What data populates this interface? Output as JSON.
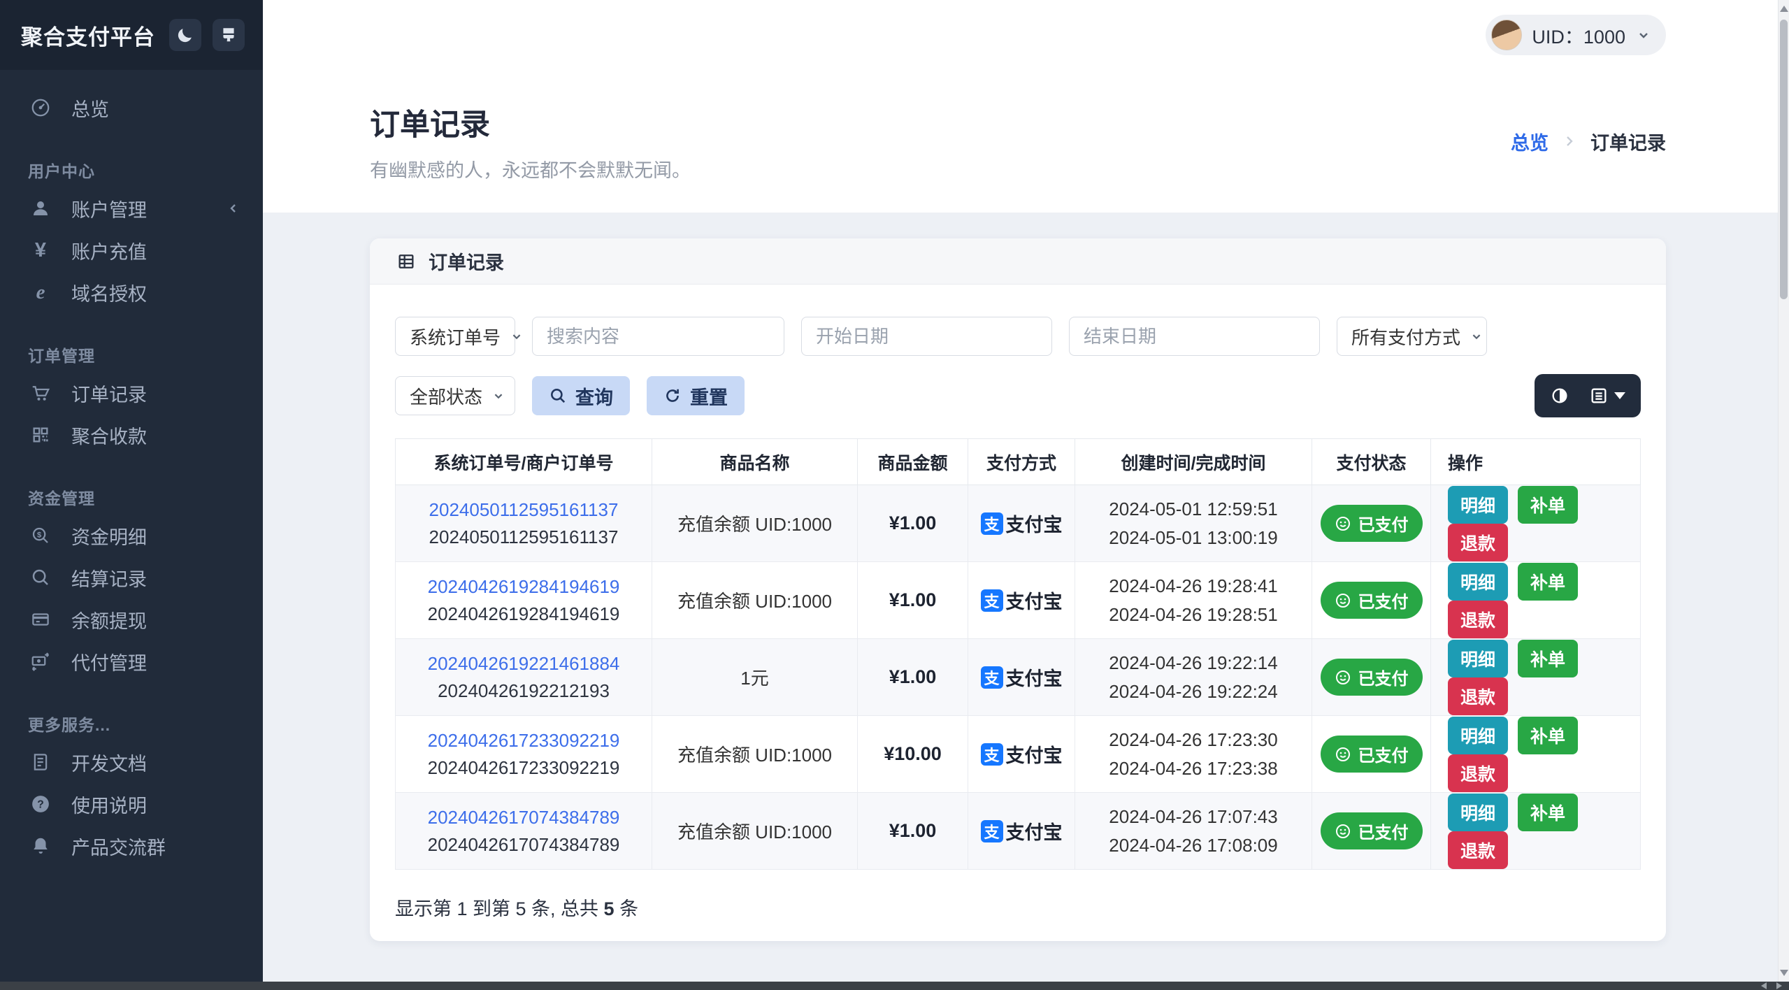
{
  "brand": {
    "title": "聚合支付平台"
  },
  "topbar": {
    "uid": "UID：1000"
  },
  "sidebar": {
    "overview": "总览",
    "sections": [
      {
        "label": "用户中心",
        "items": [
          "账户管理",
          "账户充值",
          "域名授权"
        ]
      },
      {
        "label": "订单管理",
        "items": [
          "订单记录",
          "聚合收款"
        ]
      },
      {
        "label": "资金管理",
        "items": [
          "资金明细",
          "结算记录",
          "余额提现",
          "代付管理"
        ]
      },
      {
        "label": "更多服务...",
        "items": [
          "开发文档",
          "使用说明",
          "产品交流群"
        ]
      }
    ]
  },
  "page": {
    "title": "订单记录",
    "subtitle": "有幽默感的人，永远都不会默默无闻。",
    "breadcrumb_home": "总览",
    "breadcrumb_current": "订单记录"
  },
  "card": {
    "title": "订单记录"
  },
  "filters": {
    "order_no_type": "系统订单号",
    "search_placeholder": "搜索内容",
    "start_date_placeholder": "开始日期",
    "end_date_placeholder": "结束日期",
    "pay_method_all": "所有支付方式",
    "status_all": "全部状态",
    "query": "查询",
    "reset": "重置"
  },
  "icons": {
    "alipay_glyph": "支",
    "yen_glyph": "¥",
    "explorer_glyph": "e",
    "search_dollar_glyph": "$",
    "question_glyph": "?"
  },
  "table": {
    "columns": [
      "系统订单号/商户订单号",
      "商品名称",
      "商品金额",
      "支付方式",
      "创建时间/完成时间",
      "支付状态",
      "操作"
    ],
    "rows": [
      {
        "sys_no": "2024050112595161137",
        "merchant_no": "2024050112595161137",
        "product": "充值余额 UID:1000",
        "amount": "¥1.00",
        "pay_method": "支付宝",
        "created": "2024-05-01 12:59:51",
        "completed": "2024-05-01 13:00:19",
        "status": "已支付",
        "actions": [
          "明细",
          "补单",
          "退款"
        ]
      },
      {
        "sys_no": "2024042619284194619",
        "merchant_no": "2024042619284194619",
        "product": "充值余额 UID:1000",
        "amount": "¥1.00",
        "pay_method": "支付宝",
        "created": "2024-04-26 19:28:41",
        "completed": "2024-04-26 19:28:51",
        "status": "已支付",
        "actions": [
          "明细",
          "补单",
          "退款"
        ]
      },
      {
        "sys_no": "2024042619221461884",
        "merchant_no": "20240426192212193",
        "product": "1元",
        "amount": "¥1.00",
        "pay_method": "支付宝",
        "created": "2024-04-26 19:22:14",
        "completed": "2024-04-26 19:22:24",
        "status": "已支付",
        "actions": [
          "明细",
          "补单",
          "退款"
        ]
      },
      {
        "sys_no": "2024042617233092219",
        "merchant_no": "2024042617233092219",
        "product": "充值余额 UID:1000",
        "amount": "¥10.00",
        "pay_method": "支付宝",
        "created": "2024-04-26 17:23:30",
        "completed": "2024-04-26 17:23:38",
        "status": "已支付",
        "actions": [
          "明细",
          "补单",
          "退款"
        ]
      },
      {
        "sys_no": "2024042617074384789",
        "merchant_no": "2024042617074384789",
        "product": "充值余额 UID:1000",
        "amount": "¥1.00",
        "pay_method": "支付宝",
        "created": "2024-04-26 17:07:43",
        "completed": "2024-04-26 17:08:09",
        "status": "已支付",
        "actions": [
          "明细",
          "补单",
          "退款"
        ]
      }
    ],
    "summary_prefix": "显示第 1 到第 5 条, 总共 ",
    "summary_total": "5",
    "summary_suffix": " 条"
  },
  "colors": {
    "sidebar_bg": "#212b3a",
    "alipay_blue": "#1677ff",
    "success_green": "#28a745",
    "info_teal": "#1d9cb4",
    "danger_red": "#d8334f",
    "link_blue": "#3d6eea",
    "soft_button_bg": "#c8d9f6"
  }
}
